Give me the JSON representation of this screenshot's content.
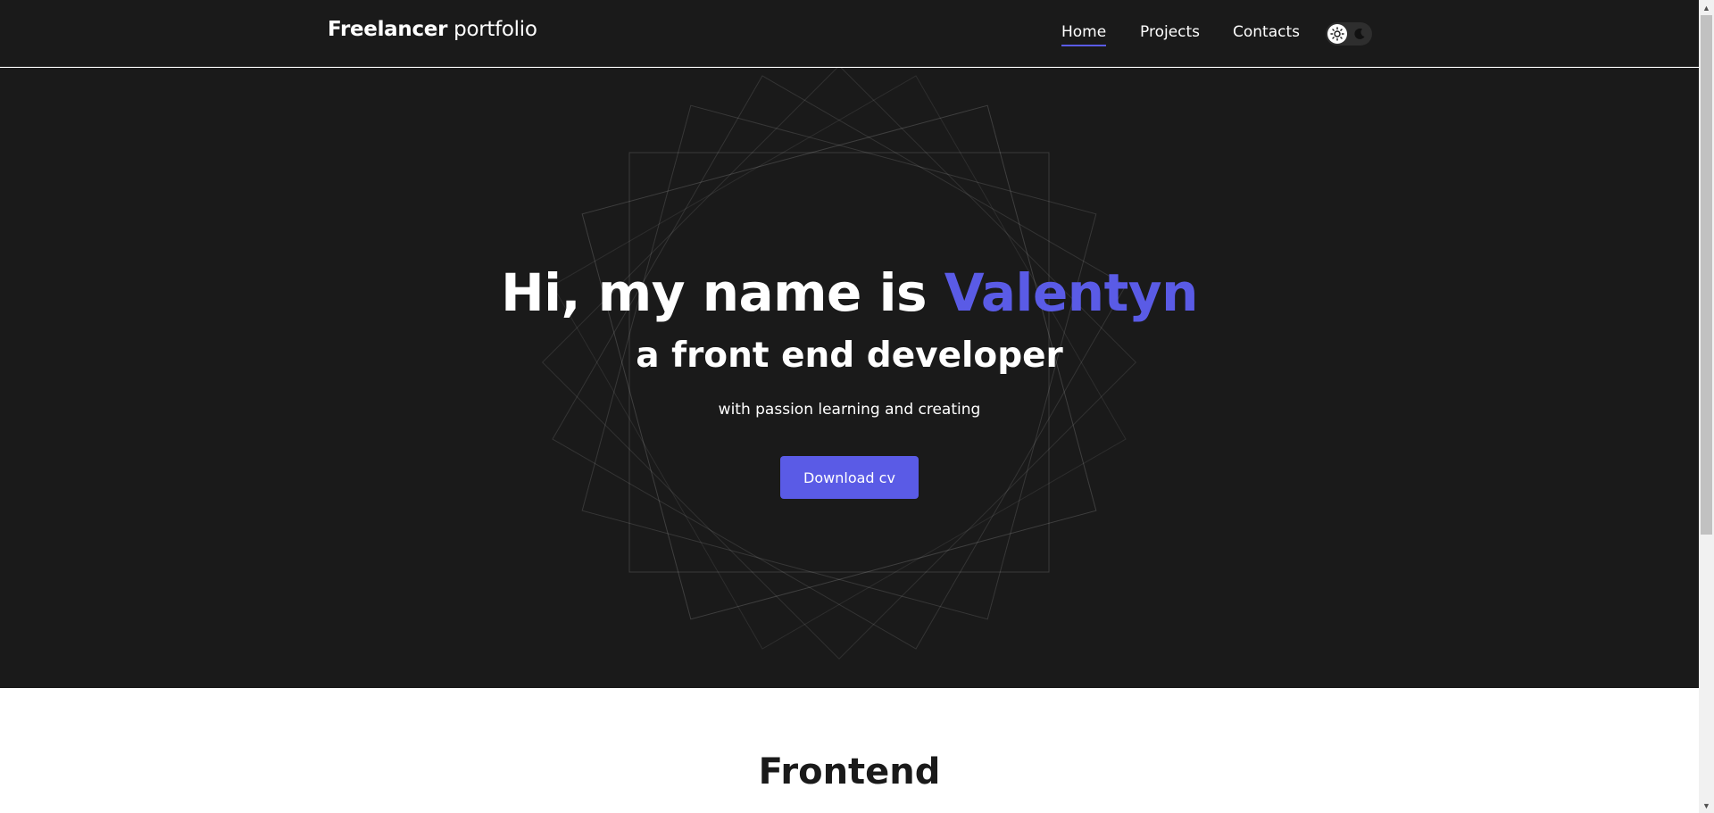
{
  "header": {
    "logo_bold": "Freelancer",
    "logo_light": "portfolio",
    "nav": [
      {
        "label": "Home",
        "active": true
      },
      {
        "label": "Projects",
        "active": false
      },
      {
        "label": "Contacts",
        "active": false
      }
    ],
    "theme_toggle": {
      "light_icon": "sun-icon",
      "dark_icon": "moon-icon"
    }
  },
  "hero": {
    "title_prefix": "Hi, my name is",
    "title_name": "Valentyn",
    "subtitle": "a front end developer",
    "tagline": "with passion learning and creating",
    "cta_label": "Download cv"
  },
  "section": {
    "title": "Frontend"
  },
  "colors": {
    "accent": "#5a5be6",
    "dark_bg": "#1a1a1a",
    "light_bg": "#ffffff"
  }
}
